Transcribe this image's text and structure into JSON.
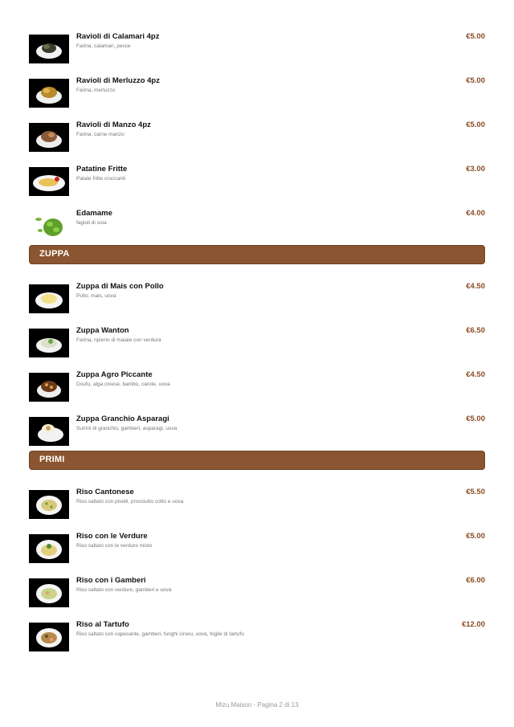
{
  "sections": [
    {
      "title": "",
      "items": [
        {
          "name": "Ravioli di Calamari 4pz",
          "description": "Farina, calamari, pesce",
          "price": "€5.00"
        },
        {
          "name": "Ravioli di Merluzzo 4pz",
          "description": "Farina, merluzzo",
          "price": "€5.00"
        },
        {
          "name": "Ravioli di Manzo 4pz",
          "description": "Farina, carne manzo",
          "price": "€5.00"
        },
        {
          "name": "Patatine Fritte",
          "description": "Patate fritte croccanti",
          "price": "€3.00"
        },
        {
          "name": "Edamame",
          "description": "fagioli di soia",
          "price": "€4.00"
        }
      ]
    },
    {
      "title": "ZUPPA",
      "items": [
        {
          "name": "Zuppa di Mais con Pollo",
          "description": "Pollo, mais, uova",
          "price": "€4.50"
        },
        {
          "name": "Zuppa Wanton",
          "description": "Farina, ripieno di maiale con verdura",
          "price": "€6.50"
        },
        {
          "name": "Zuppa Agro Piccante",
          "description": "Doufu, alga cinese, bambù, carote, uova",
          "price": "€4.50"
        },
        {
          "name": "Zuppa Granchio Asparagi",
          "description": "Surimi di granchio, gamberi, asparagi, uova",
          "price": "€5.00"
        }
      ]
    },
    {
      "title": "PRIMI",
      "items": [
        {
          "name": "Riso Cantonese",
          "description": "Riso saltato con piselli, prosciutto cotto e uova",
          "price": "€5.50"
        },
        {
          "name": "Riso con le Verdure",
          "description": "Riso saltato con le verdure misto",
          "price": "€5.00"
        },
        {
          "name": "Riso con i Gamberi",
          "description": "Riso saltato con verdure, gamberi e uova",
          "price": "€6.00"
        },
        {
          "name": "Riso al Tartufo",
          "description": "Riso saltato con capesante, gamberi, funghi cinesi, uova, foglie di tartufo",
          "price": "€12.00"
        }
      ]
    }
  ],
  "footer": "Mizu Maison - Pagina 2 di 13",
  "colors": {
    "accent": "#8a5530",
    "price": "#8b4a23"
  }
}
